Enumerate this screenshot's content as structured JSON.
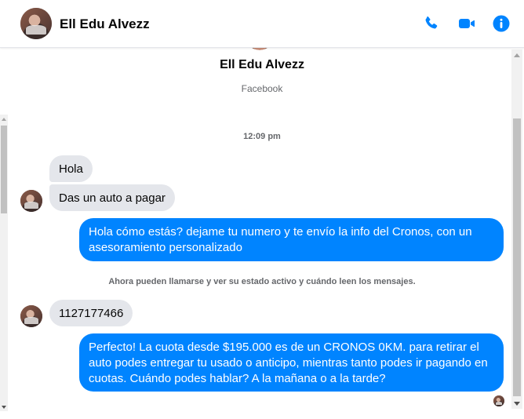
{
  "header": {
    "contact_name": "Ell Edu Alvezz",
    "icons": [
      "phone-icon",
      "video-icon",
      "info-icon"
    ],
    "accent_color": "#0084ff"
  },
  "conversation": {
    "profile_name": "Ell Edu Alvezz",
    "profile_source": "Facebook",
    "timestamp": "12:09 pm",
    "notice": "Ahora pueden llamarse y ver su estado activo y cuándo leen los mensajes.",
    "messages": [
      {
        "sender": "incoming",
        "text": "Hola"
      },
      {
        "sender": "incoming",
        "text": "Das un auto a pagar"
      },
      {
        "sender": "outgoing",
        "text": "Hola cómo estás? dejame tu numero  y te envío la info del Cronos, con un asesoramiento personalizado"
      },
      {
        "sender": "incoming",
        "text": "1127177466"
      },
      {
        "sender": "outgoing",
        "text": "Perfecto! La cuota desde $195.000 es de un CRONOS 0KM. para retirar el auto podes entregar tu usado o anticipo, mientras tanto podes ir pagando en cuotas. Cuándo podes hablar? A la mañana o a la tarde?"
      }
    ]
  },
  "colors": {
    "incoming_bubble": "#e4e6eb",
    "outgoing_bubble": "#0084ff"
  }
}
